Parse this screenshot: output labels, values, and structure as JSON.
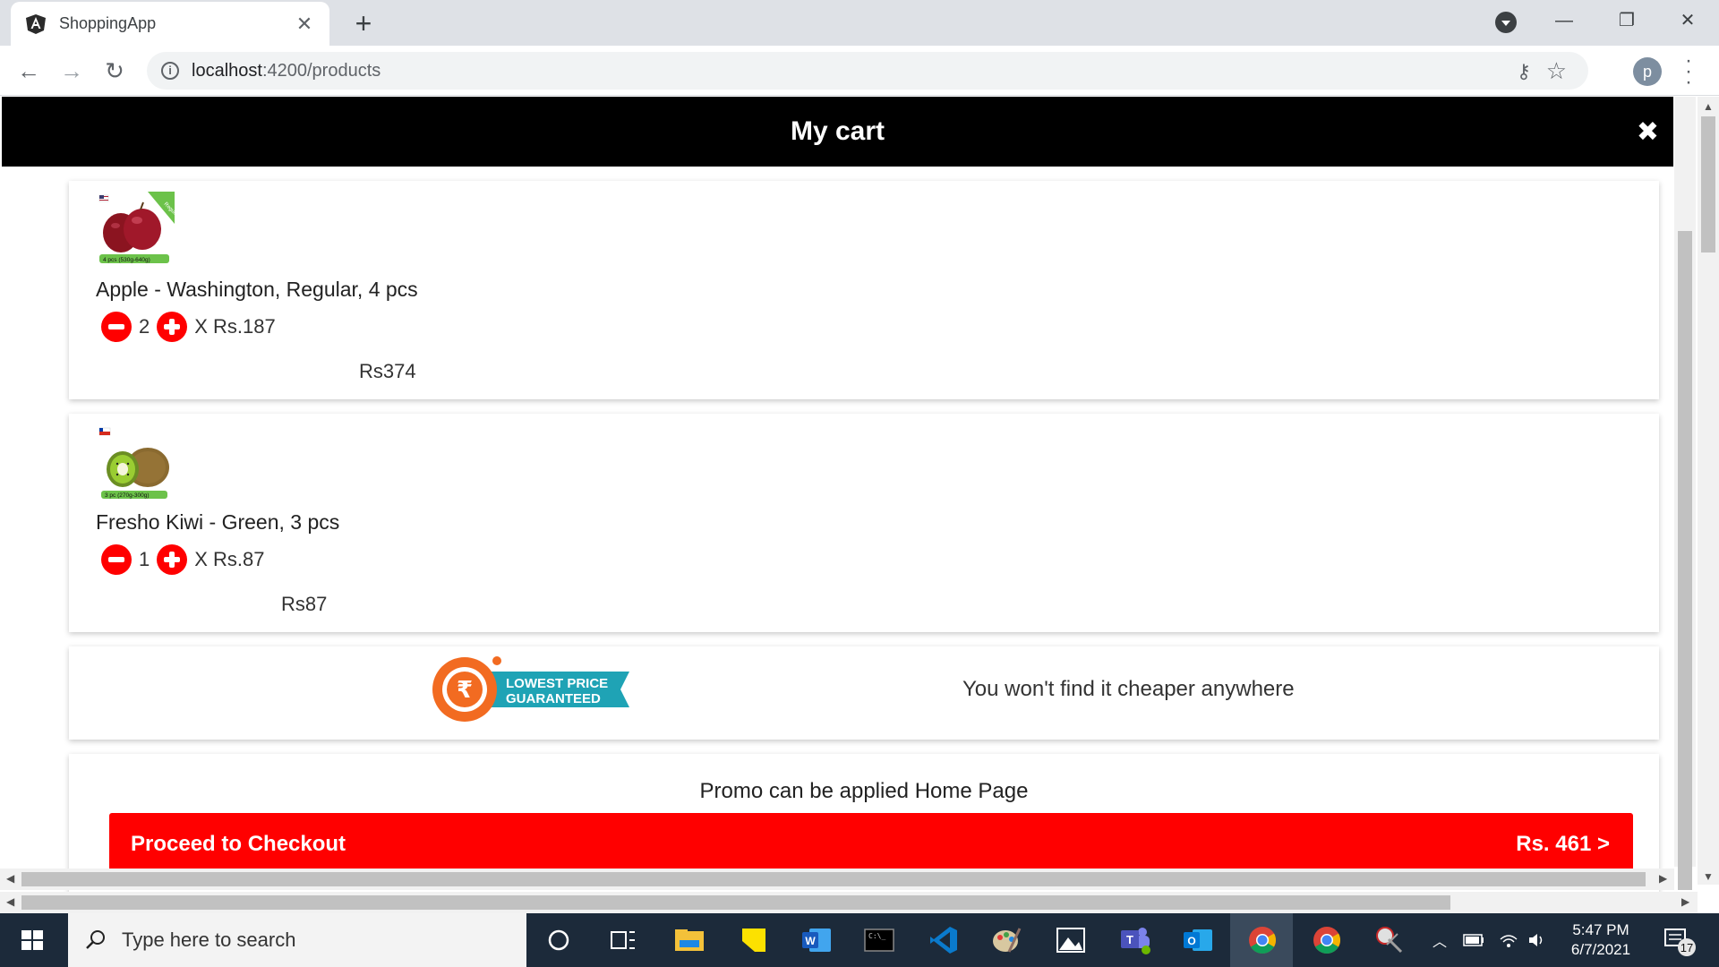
{
  "browser": {
    "tab_title": "ShoppingApp",
    "tab_close": "✕",
    "new_tab": "+",
    "url_host": "localhost",
    "url_path": ":4200/products",
    "profile_initial": "p"
  },
  "cart": {
    "title": "My cart",
    "close_icon": "✖",
    "items": [
      {
        "name": "Apple - Washington, Regular, 4 pcs",
        "quantity": "2",
        "unit_price": "X Rs.187",
        "subtotal": "Rs374",
        "image_caption": "4 pcs (530g-640g)",
        "image_ribbon": "Regular"
      },
      {
        "name": "Fresho Kiwi - Green, 3 pcs",
        "quantity": "1",
        "unit_price": "X Rs.87",
        "subtotal": "Rs87",
        "image_caption": "3 pc (270g-300g)"
      }
    ],
    "badge_line1": "LOWEST PRICE",
    "badge_line2": "GUARANTEED",
    "badge_symbol": "₹",
    "guarantee_text": "You won't find it cheaper anywhere",
    "promo_note": "Promo can be applied Home Page",
    "checkout_label": "Proceed to Checkout",
    "checkout_total": "Rs. 461 >"
  },
  "taskbar": {
    "search_placeholder": "Type here to search",
    "time": "5:47 PM",
    "date": "6/7/2021",
    "notification_count": "17"
  },
  "colors": {
    "accent_red": "#ff0000",
    "header_black": "#000000",
    "badge_orange": "#f26b21",
    "badge_teal": "#1fa3b5"
  }
}
